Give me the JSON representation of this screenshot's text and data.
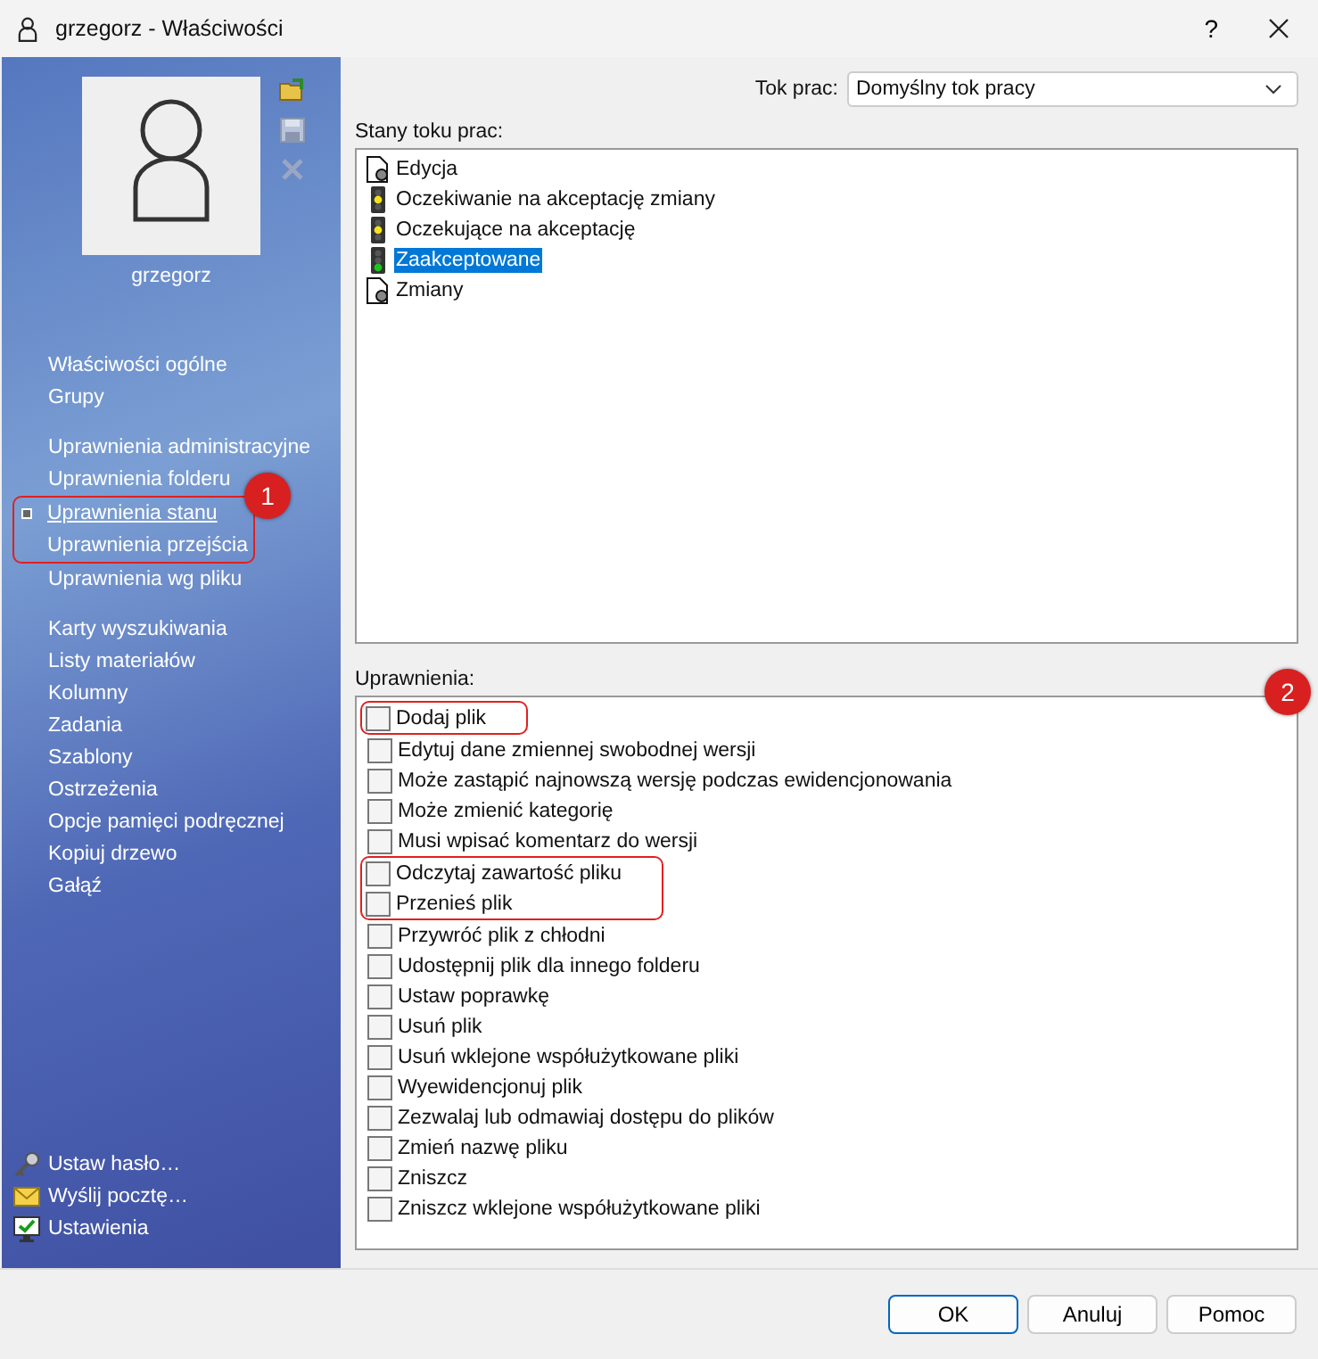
{
  "window": {
    "title": "grzegorz - Właściwości",
    "help": "?"
  },
  "sidebar": {
    "user_name": "grzegorz",
    "nav_groups": [
      [
        {
          "label": "Właściwości ogólne",
          "selected": false,
          "highlighted": false
        },
        {
          "label": "Grupy",
          "selected": false,
          "highlighted": false
        }
      ],
      [
        {
          "label": "Uprawnienia administracyjne",
          "selected": false,
          "highlighted": false
        },
        {
          "label": "Uprawnienia folderu",
          "selected": false,
          "highlighted": false
        },
        {
          "label": "Uprawnienia stanu",
          "selected": true,
          "highlighted": true
        },
        {
          "label": "Uprawnienia przejścia",
          "selected": false,
          "highlighted": true
        },
        {
          "label": "Uprawnienia wg pliku",
          "selected": false,
          "highlighted": false
        }
      ],
      [
        {
          "label": "Karty wyszukiwania",
          "selected": false,
          "highlighted": false
        },
        {
          "label": "Listy materiałów",
          "selected": false,
          "highlighted": false
        },
        {
          "label": "Kolumny",
          "selected": false,
          "highlighted": false
        },
        {
          "label": "Zadania",
          "selected": false,
          "highlighted": false
        },
        {
          "label": "Szablony",
          "selected": false,
          "highlighted": false
        },
        {
          "label": "Ostrzeżenia",
          "selected": false,
          "highlighted": false
        },
        {
          "label": "Opcje pamięci podręcznej",
          "selected": false,
          "highlighted": false
        },
        {
          "label": "Kopiuj drzewo",
          "selected": false,
          "highlighted": false
        },
        {
          "label": "Gałąź",
          "selected": false,
          "highlighted": false
        }
      ]
    ],
    "nav_badge": "1",
    "actions": [
      {
        "kind": "key",
        "label": "Ustaw hasło…"
      },
      {
        "kind": "mail",
        "label": "Wyślij pocztę…"
      },
      {
        "kind": "monitor",
        "label": "Ustawienia"
      }
    ]
  },
  "workflow": {
    "label": "Tok prac:",
    "value": "Domyślny tok pracy"
  },
  "states": {
    "label": "Stany toku prac:",
    "items": [
      {
        "kind": "document",
        "label": "Edycja",
        "selected": false
      },
      {
        "kind": "light-yellow",
        "label": "Oczekiwanie na akceptację zmiany",
        "selected": false
      },
      {
        "kind": "light-yellow",
        "label": "Oczekujące na akceptację",
        "selected": false
      },
      {
        "kind": "light-green",
        "label": "Zaakceptowane",
        "selected": true
      },
      {
        "kind": "document",
        "label": "Zmiany",
        "selected": false
      }
    ]
  },
  "permissions": {
    "label": "Uprawnienia:",
    "badge": "2",
    "items": [
      {
        "label": "Dodaj plik",
        "checked": false,
        "highlighted": true
      },
      {
        "label": "Edytuj dane zmiennej swobodnej wersji",
        "checked": false,
        "highlighted": false
      },
      {
        "label": "Może zastąpić najnowszą wersję podczas ewidencjonowania",
        "checked": false,
        "highlighted": false
      },
      {
        "label": "Może zmienić kategorię",
        "checked": false,
        "highlighted": false
      },
      {
        "label": "Musi wpisać komentarz do wersji",
        "checked": false,
        "highlighted": false
      },
      {
        "label": "Odczytaj zawartość pliku",
        "checked": false,
        "highlighted": true
      },
      {
        "label": "Przenieś plik",
        "checked": false,
        "highlighted": true
      },
      {
        "label": "Przywróć plik z chłodni",
        "checked": false,
        "highlighted": false
      },
      {
        "label": "Udostępnij plik dla innego folderu",
        "checked": false,
        "highlighted": false
      },
      {
        "label": "Ustaw poprawkę",
        "checked": false,
        "highlighted": false
      },
      {
        "label": "Usuń plik",
        "checked": false,
        "highlighted": false
      },
      {
        "label": "Usuń wklejone współużytkowane  pliki",
        "checked": false,
        "highlighted": false
      },
      {
        "label": "Wyewidencjonuj plik",
        "checked": false,
        "highlighted": false
      },
      {
        "label": "Zezwalaj lub odmawiaj dostępu do plików",
        "checked": false,
        "highlighted": false
      },
      {
        "label": "Zmień nazwę pliku",
        "checked": false,
        "highlighted": false
      },
      {
        "label": "Zniszcz",
        "checked": false,
        "highlighted": false
      },
      {
        "label": "Zniszcz wklejone współużytkowane pliki",
        "checked": false,
        "highlighted": false
      }
    ]
  },
  "buttons": [
    {
      "label": "OK",
      "default": true
    },
    {
      "label": "Anuluj",
      "default": false
    },
    {
      "label": "Pomoc",
      "default": false
    }
  ]
}
